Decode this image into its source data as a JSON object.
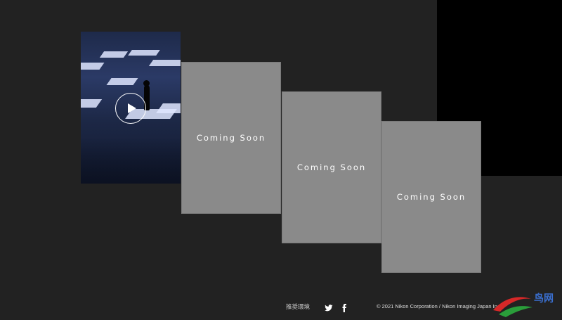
{
  "cards": [
    {
      "type": "video",
      "play_label": "play"
    },
    {
      "type": "placeholder",
      "label": "Coming Soon"
    },
    {
      "type": "placeholder",
      "label": "Coming Soon"
    },
    {
      "type": "placeholder",
      "label": "Coming Soon"
    }
  ],
  "footer": {
    "recommended_env": "推奨環境",
    "copyright": "© 2021 Nikon Corporation / Nikon Imaging Japan Inc."
  },
  "watermark": {
    "text": "鸟网"
  },
  "colors": {
    "background": "#222222",
    "card_placeholder": "#8a8a8a",
    "panel_black": "#000000",
    "text_white": "#ffffff"
  },
  "icons": [
    "play-icon",
    "twitter-icon",
    "facebook-icon"
  ]
}
